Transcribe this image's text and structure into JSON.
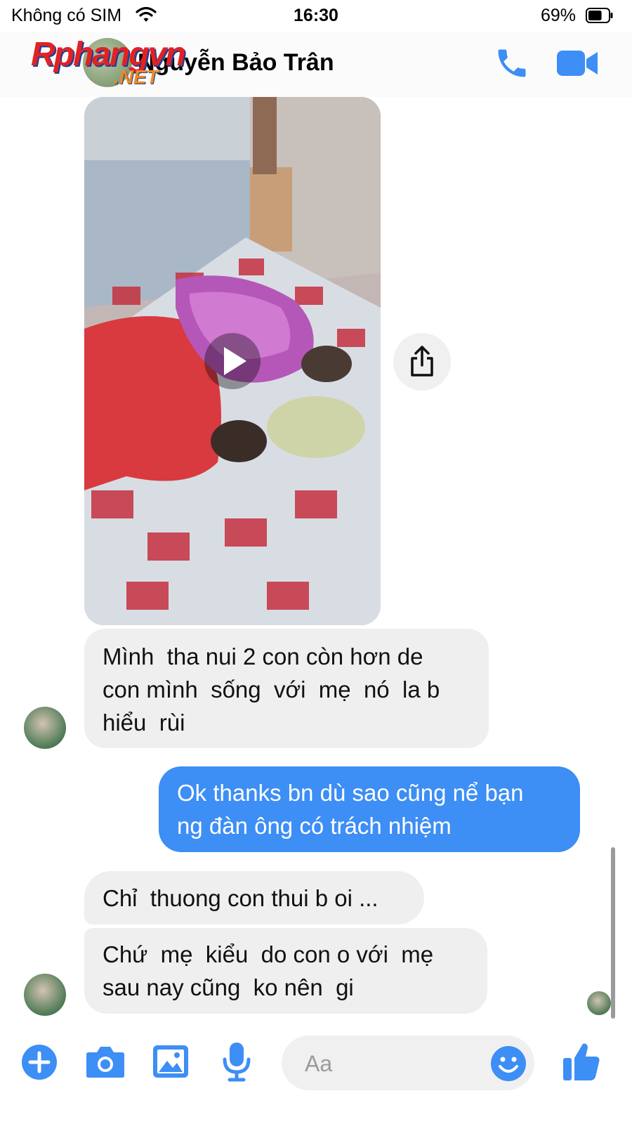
{
  "status_bar": {
    "carrier": "Không có SIM",
    "time": "16:30",
    "battery_percent": "69%",
    "battery_level": 0.69
  },
  "header": {
    "contact_name": "Nguyễn Bảo Trân",
    "watermark_main": "Rphangvn",
    "watermark_sub": ".NET"
  },
  "messages": [
    {
      "type": "video",
      "direction": "incoming"
    },
    {
      "type": "text",
      "direction": "incoming",
      "lines": [
        "Mình  tha nui 2 con còn hơn de",
        "con mình  sống  với  mẹ  nó  la b",
        "hiểu  rùi"
      ]
    },
    {
      "type": "text",
      "direction": "outgoing",
      "lines": [
        "Ok thanks bn dù sao cũng nể bạn",
        "ng đàn ông có trách nhiệm"
      ]
    },
    {
      "type": "text",
      "direction": "incoming",
      "lines": [
        "Chỉ  thuong con thui b oi ..."
      ]
    },
    {
      "type": "text",
      "direction": "incoming",
      "lines": [
        "Chứ  mẹ  kiểu  do con o với  mẹ",
        "sau nay cũng  ko nên  gi"
      ]
    }
  ],
  "composer": {
    "placeholder": "Aa"
  },
  "colors": {
    "messenger_blue": "#3d8ef5",
    "incoming_bubble": "#efefef"
  },
  "icons": [
    "wifi-icon",
    "battery-icon",
    "phone-icon",
    "video-call-icon",
    "play-icon",
    "share-icon",
    "plus-icon",
    "camera-icon",
    "image-icon",
    "microphone-icon",
    "emoji-icon",
    "thumbs-up-icon"
  ]
}
